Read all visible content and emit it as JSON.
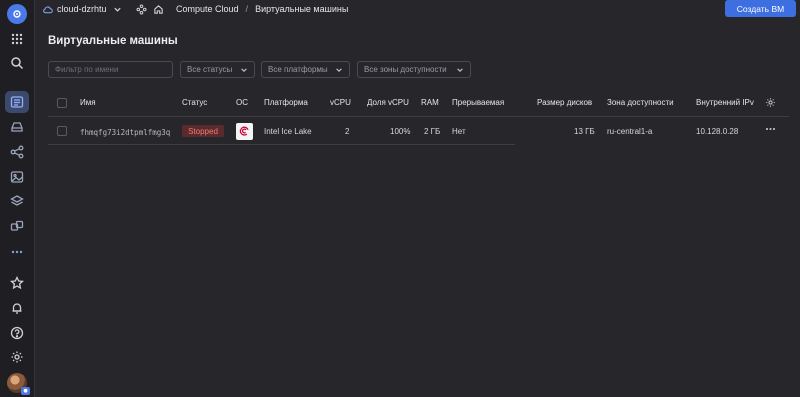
{
  "colors": {
    "background": "#27272b",
    "rail": "#1f1f23",
    "accent": "#3d6fe0",
    "status_stopped_bg": "#5a2a2c",
    "status_stopped_fg": "#f07a7a"
  },
  "topbar": {
    "cloud_name": "cloud-dzrhtu",
    "breadcrumb": [
      "Compute Cloud",
      "Виртуальные машины"
    ],
    "breadcrumb_sep": "/",
    "create_button": "Создать ВМ"
  },
  "page": {
    "title": "Виртуальные машины"
  },
  "filters": {
    "name_placeholder": "Фильтр по имени",
    "status_select": "Все статусы",
    "platform_select": "Все платформы",
    "zone_select": "Все зоны доступности"
  },
  "table": {
    "headers": [
      "Имя",
      "Статус",
      "ОС",
      "Платформа",
      "vCPU",
      "Доля vCPU",
      "RAM",
      "Прерываемая",
      "Размер дисков",
      "Зона доступности",
      "Внутренний IPv"
    ],
    "rows": [
      {
        "name": "fhmqfg73i2dtpmlfmg3q",
        "status": "Stopped",
        "os_icon": "debian-icon",
        "platform": "Intel Ice Lake",
        "vcpu": "2",
        "vcpu_share": "100%",
        "ram": "2 ГБ",
        "preemptible": "Нет",
        "disk_size": "13 ГБ",
        "zone": "ru-central1-a",
        "internal_ip": "10.128.0.28"
      }
    ]
  },
  "rail_icons": [
    "settings-logo-icon",
    "apps-grid-icon",
    "search-icon",
    "vm-list-icon",
    "disk-icon",
    "network-icon",
    "image-icon",
    "layers-icon",
    "cubes-icon",
    "more-icon",
    "star-icon",
    "bell-icon",
    "help-icon",
    "gear-icon",
    "avatar"
  ]
}
